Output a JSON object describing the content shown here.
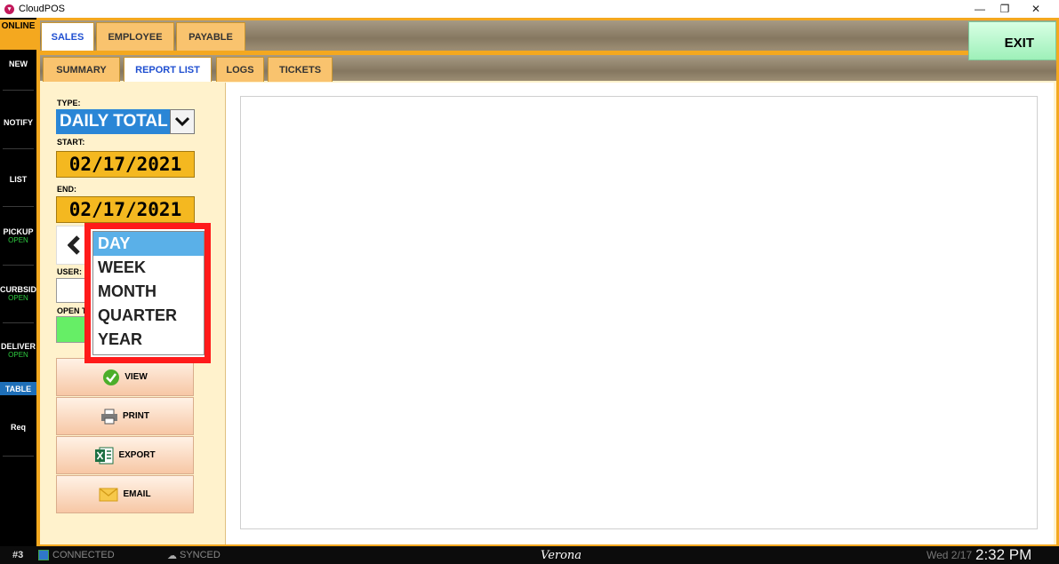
{
  "window": {
    "title": "CloudPOS"
  },
  "leftnav": {
    "online": "ONLINE",
    "items": [
      {
        "label": "NEW",
        "sub": ""
      },
      {
        "label": "NOTIFY",
        "sub": ""
      },
      {
        "label": "LIST",
        "sub": ""
      },
      {
        "label": "PICKUP",
        "sub": "OPEN"
      },
      {
        "label": "CURBSID",
        "sub": "OPEN"
      },
      {
        "label": "DELIVER",
        "sub": "OPEN"
      },
      {
        "label": "TABLE",
        "sub": ""
      },
      {
        "label": "Req",
        "sub": ""
      }
    ]
  },
  "tabs": [
    "SALES",
    "EMPLOYEE",
    "PAYABLE"
  ],
  "subtabs": [
    "SUMMARY",
    "REPORT LIST",
    "LOGS",
    "TICKETS"
  ],
  "exit_label": "EXIT",
  "form": {
    "type_label": "TYPE:",
    "type_value": "DAILY TOTAL",
    "start_label": "START:",
    "start_value": "02/17/2021",
    "end_label": "END:",
    "end_value": "02/17/2021",
    "user_label": "USER:",
    "open_label": "OPEN T"
  },
  "period_dropdown": {
    "options": [
      "DAY",
      "WEEK",
      "MONTH",
      "QUARTER",
      "YEAR"
    ],
    "selected": "DAY"
  },
  "actions": {
    "view": "VIEW",
    "print": "PRINT",
    "export": "EXPORT",
    "email": "EMAIL"
  },
  "status": {
    "terminal": "#3",
    "connected": "CONNECTED",
    "synced": "SYNCED",
    "store": "Verona",
    "date": "Wed 2/17",
    "time": "2:32 PM"
  },
  "colors": {
    "accent": "#f4a81f",
    "active_tab_text": "#1f4fd1",
    "dropdown_highlight": "#5ab0e8",
    "popup_border": "#ff1a1a"
  }
}
